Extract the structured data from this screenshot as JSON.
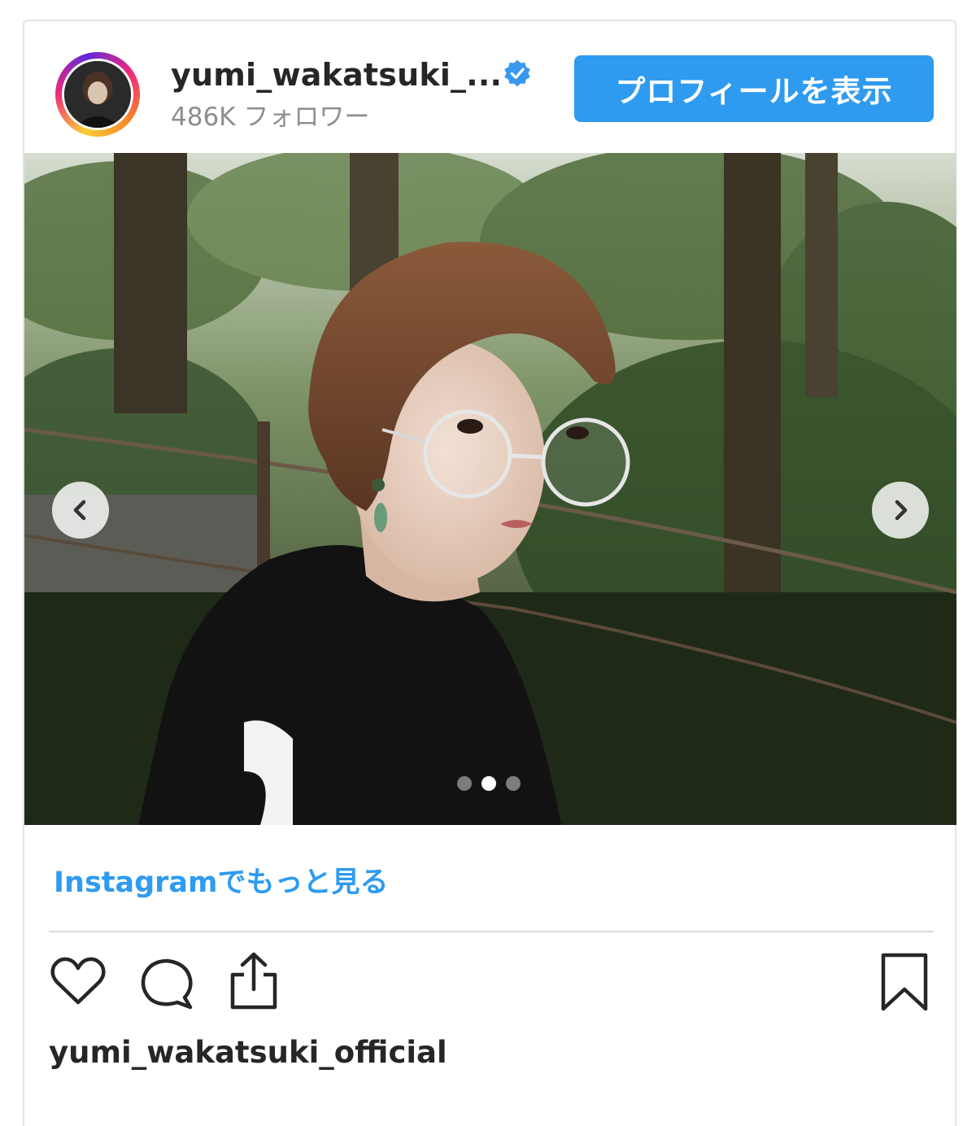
{
  "post": {
    "username": "yumi_wakatsuki_...",
    "followers": "486K フォロワー",
    "profile_button": "プロフィールを表示",
    "more_link": "Instagramでもっと見る",
    "owner_name": "yumi_wakatsuki_official",
    "carousel": {
      "total_slides": 3,
      "active_slide": 2
    }
  },
  "colors": {
    "accent": "#2e9bf0",
    "text": "#262626",
    "muted": "#8e8e8e",
    "divider": "#dbdbdb"
  },
  "icons": {
    "verified": "verified-badge-icon",
    "prev": "chevron-left-icon",
    "next": "chevron-right-icon",
    "like": "heart-icon",
    "comment": "comment-bubble-icon",
    "share": "share-upload-icon",
    "save": "bookmark-icon"
  }
}
